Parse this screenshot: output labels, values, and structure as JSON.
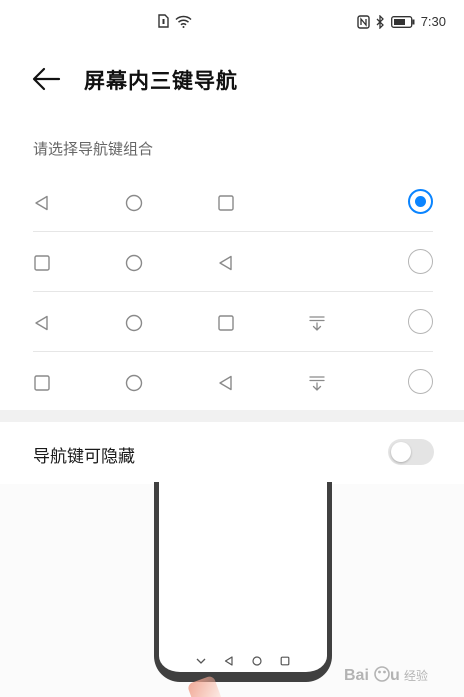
{
  "status_bar": {
    "time": "7:30",
    "icons": [
      "sim-card-icon",
      "wifi-icon",
      "nfc-icon",
      "bluetooth-icon",
      "battery-icon"
    ]
  },
  "header": {
    "title": "屏幕内三键导航",
    "back_icon": "back-arrow-icon"
  },
  "section": {
    "label": "请选择导航键组合"
  },
  "options": [
    {
      "keys": [
        "back-triangle",
        "home-circle",
        "recents-square"
      ],
      "selected": true
    },
    {
      "keys": [
        "recents-square",
        "home-circle",
        "back-triangle"
      ],
      "selected": false
    },
    {
      "keys": [
        "back-triangle",
        "home-circle",
        "recents-square",
        "notification-pull-down"
      ],
      "selected": false
    },
    {
      "keys": [
        "recents-square",
        "home-circle",
        "back-triangle",
        "notification-pull-down"
      ],
      "selected": false
    }
  ],
  "hideable": {
    "label": "导航键可隐藏",
    "enabled": false
  },
  "preview": {
    "nav_keys": [
      "hide-chevron",
      "back-triangle",
      "home-circle",
      "recents-square"
    ]
  },
  "watermark": {
    "text": "Baidu 经验"
  },
  "colors": {
    "accent": "#0a84ff",
    "icon_gray": "#8a8a8a",
    "divider": "#e6e6e6"
  }
}
